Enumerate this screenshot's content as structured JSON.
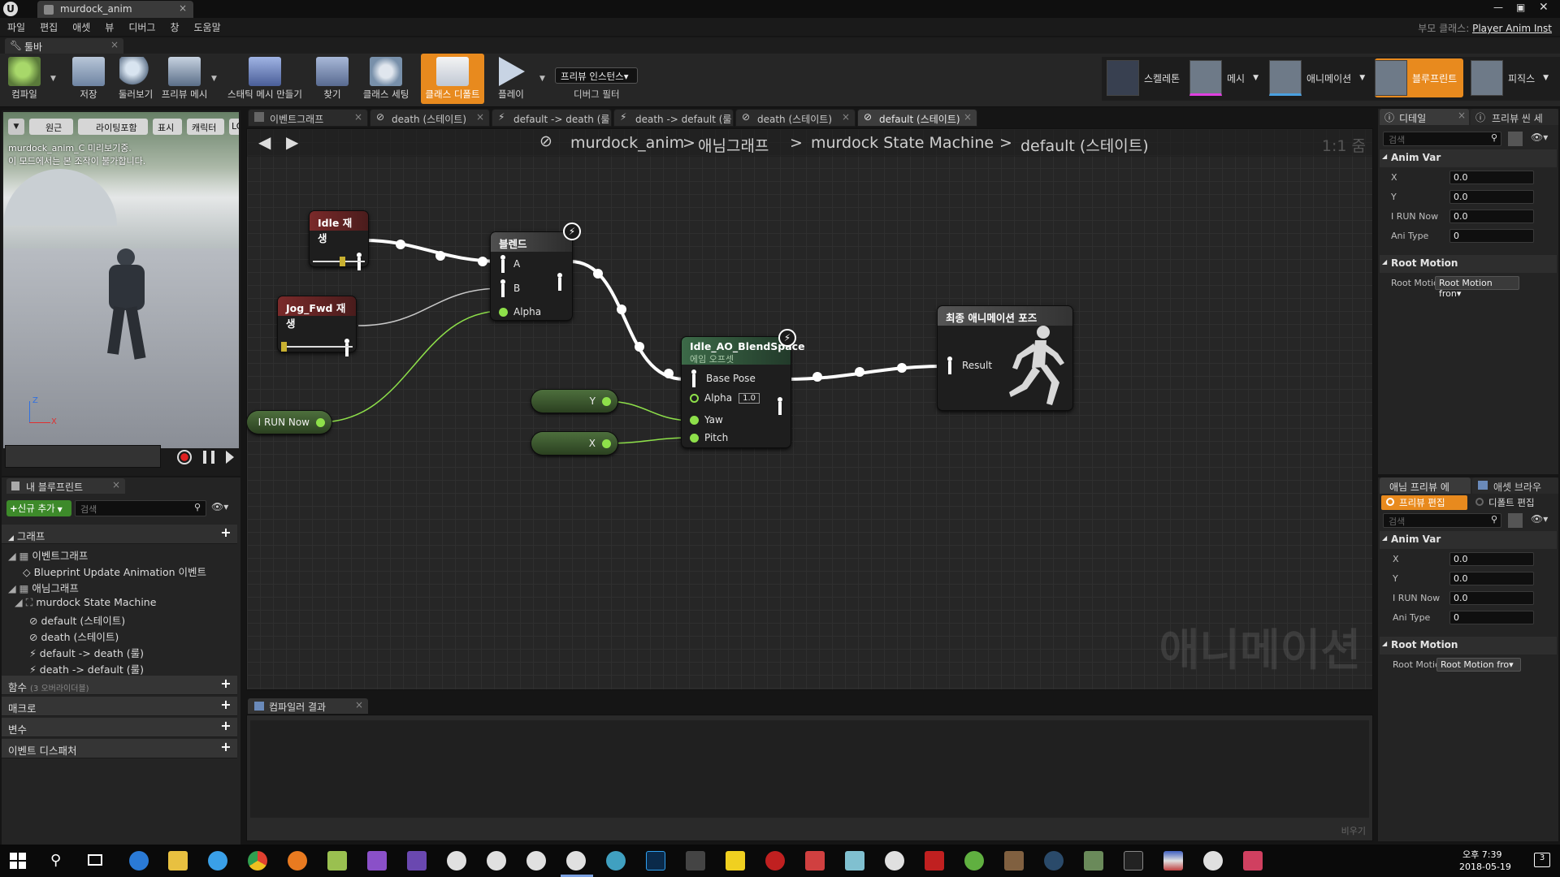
{
  "window": {
    "doc_tab": "murdock_anim",
    "parent_class_label": "부모 클래스:",
    "parent_class": "Player Anim Inst"
  },
  "menu": [
    "파일",
    "편집",
    "애셋",
    "뷰",
    "디버그",
    "창",
    "도움말"
  ],
  "toolbar_tab": "툴바",
  "toolbar": {
    "compile": "컴파일",
    "save": "저장",
    "browse": "둘러보기",
    "preview_mesh": "프리뷰 메시",
    "make_static_mesh": "스태틱 메시 만들기",
    "find": "찾기",
    "class_settings": "클래스 세팅",
    "class_defaults": "클래스 디폴트",
    "play": "플레이",
    "debug_select": "프리뷰 인스턴스▾",
    "debug_filter": "디버그 필터"
  },
  "modes": [
    "스켈레톤",
    "메시",
    "애니메이션",
    "블루프린트",
    "피직스"
  ],
  "viewport": {
    "buttons": [
      "원근",
      "라이팅포함",
      "표시",
      "캐릭터",
      "LO"
    ],
    "msg_line1": "murdock_anim_C 미리보기중.",
    "msg_line2": "이 모드에서는 본 조작이 불가합니다.",
    "axis_z": "Z",
    "axis_x": "X"
  },
  "graph_tabs": [
    "이벤트그래프",
    "death (스테이트)",
    "default -> death (룰",
    "death -> default (룰",
    "death (스테이트)",
    "default (스테이트)"
  ],
  "breadcrumb": [
    "murdock_anim",
    "애님그래프",
    "murdock State Machine",
    "default (스테이트)"
  ],
  "zoom": "1:1 줌",
  "watermark": "애니메이션",
  "nodes": {
    "idle": "Idle 재생",
    "jog": "Jog_Fwd 재생",
    "blend": "블렌드",
    "blend_a": "A",
    "blend_b": "B",
    "blend_alpha": "Alpha",
    "blendspace": "Idle_AO_BlendSpace",
    "blendspace_sub": "에임 오프셋",
    "base_pose": "Base Pose",
    "bs_alpha": "Alpha",
    "bs_alpha_val": "1.0",
    "yaw": "Yaw",
    "pitch": "Pitch",
    "final": "최종 애니메이션 포즈",
    "result": "Result",
    "var_run": "I RUN Now",
    "var_y": "Y",
    "var_x": "X"
  },
  "my_blueprint": {
    "tab": "내 블루프린트",
    "add_new": "신규 추가",
    "search_placeholder": "검색",
    "graph_hdr": "그래프",
    "event_graph": "이벤트그래프",
    "bp_update": "Blueprint Update Animation 이벤트",
    "anim_graph": "애님그래프",
    "state_machine": "murdock State Machine",
    "items": [
      "default (스테이트)",
      "death (스테이트)",
      "default -> death (룰)",
      "death -> default (룰)"
    ],
    "functions": "함수",
    "functions_note": "(3 오버라이더블)",
    "macros": "매크로",
    "variables": "변수",
    "dispatchers": "이벤트 디스패처"
  },
  "compiler": {
    "tab": "컴파일러 결과",
    "clear": "비우기"
  },
  "details": {
    "tab1": "디테일",
    "tab2": "프리뷰 씬 세",
    "search_placeholder": "검색",
    "anim_var": "Anim Var",
    "vars": [
      {
        "label": "X",
        "value": "0.0"
      },
      {
        "label": "Y",
        "value": "0.0"
      },
      {
        "label": "I RUN Now",
        "value": "0.0"
      },
      {
        "label": "Ani Type",
        "value": "0"
      }
    ],
    "root_motion": "Root Motion",
    "root_motion_label": "Root Motio",
    "root_motion_value": "Root Motion fron▾"
  },
  "preview": {
    "tab1": "애님 프리뷰 에",
    "tab2": "애셋 브라우",
    "edit_preview": "프리뷰 편집",
    "edit_defaults": "디폴트 편집",
    "search_placeholder": "검색",
    "anim_var": "Anim Var",
    "vars": [
      {
        "label": "X",
        "value": "0.0"
      },
      {
        "label": "Y",
        "value": "0.0"
      },
      {
        "label": "I RUN Now",
        "value": "0.0"
      },
      {
        "label": "Ani Type",
        "value": "0"
      }
    ],
    "root_motion": "Root Motion",
    "root_motion_label": "Root Motic",
    "root_motion_value": "Root Motion fro▾"
  },
  "taskbar": {
    "time": "오후 7:39",
    "date": "2018-05-19",
    "notif": "3"
  }
}
